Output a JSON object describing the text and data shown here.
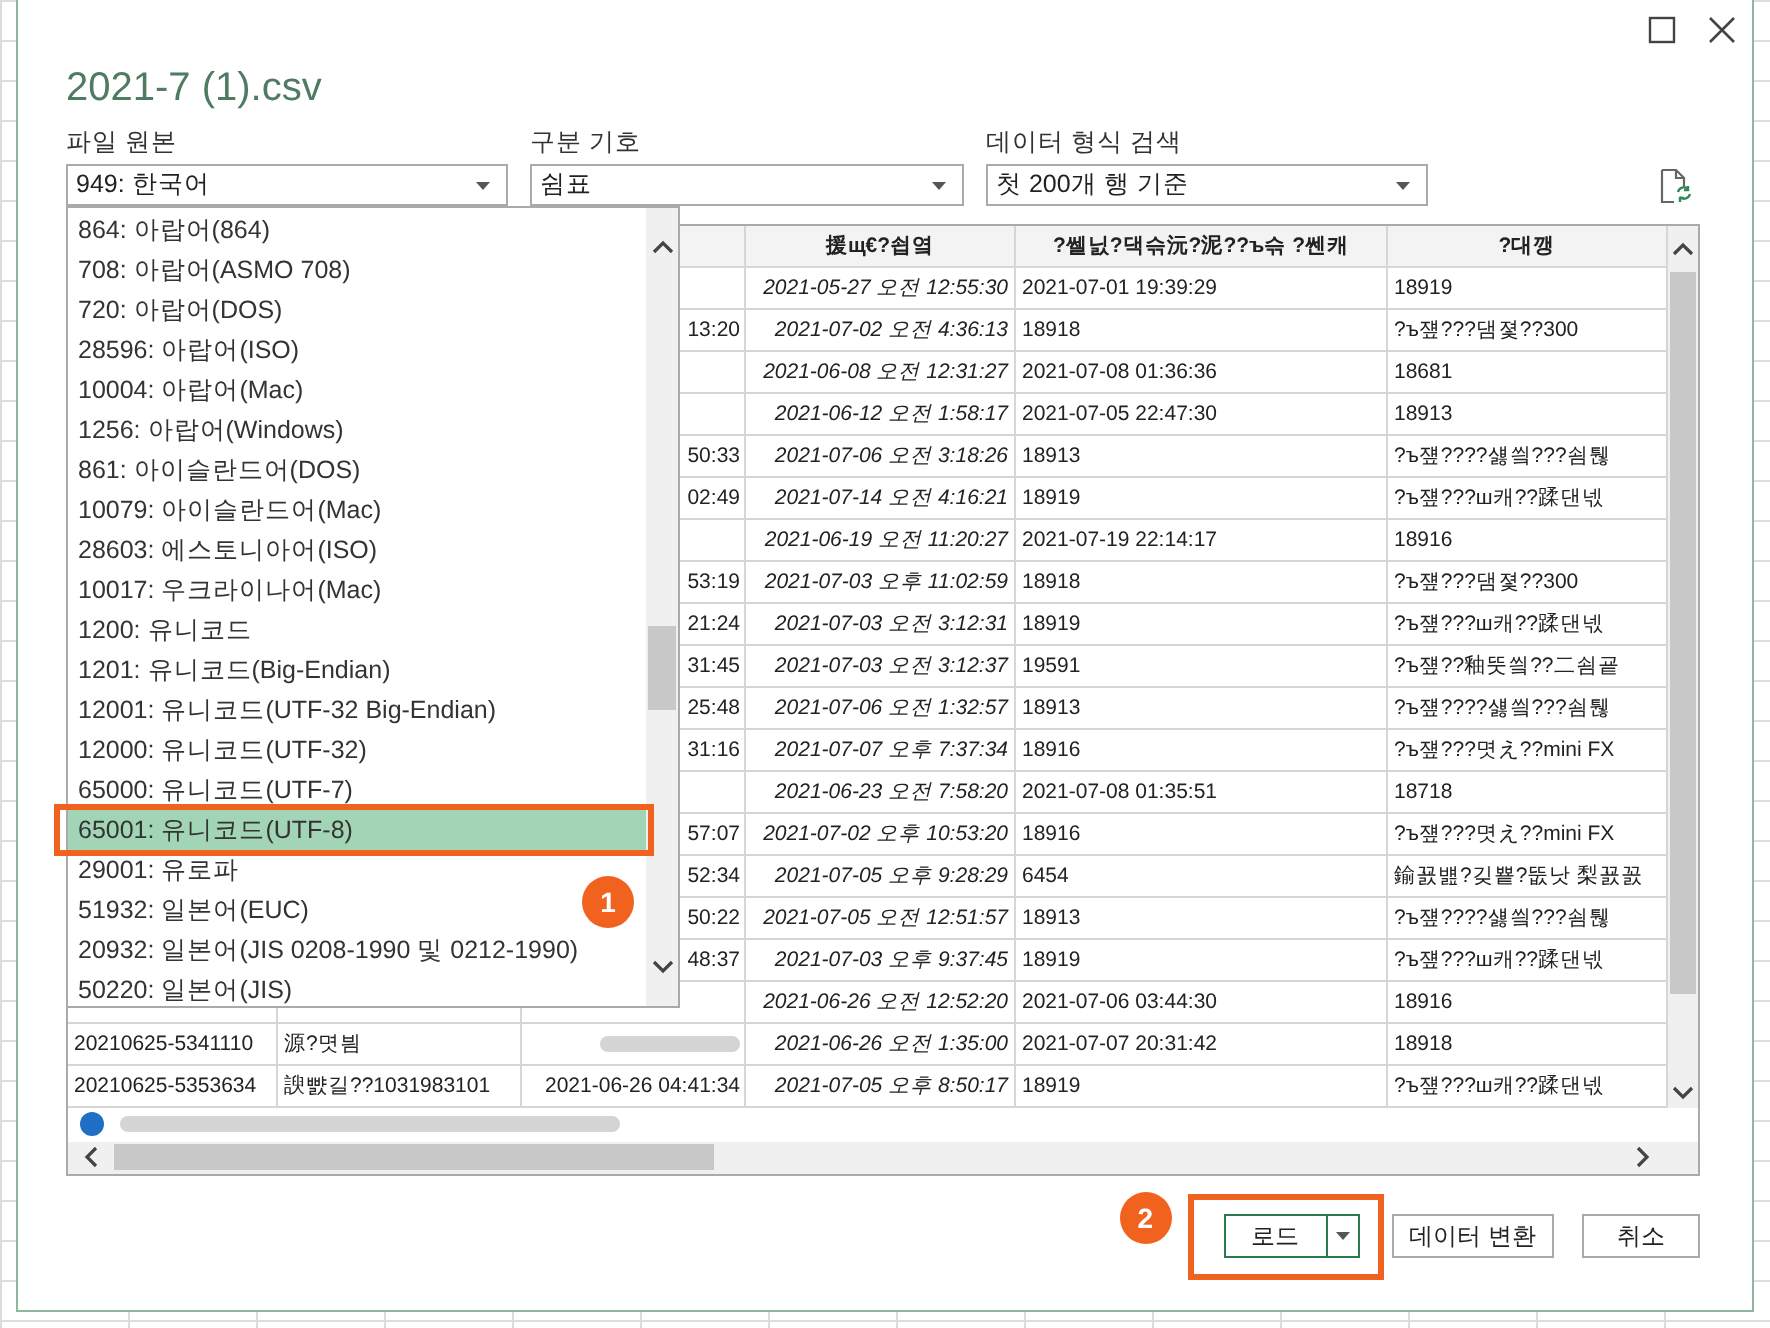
{
  "window": {
    "title": "2021-7 (1).csv"
  },
  "file_origin": {
    "label": "파일 원본",
    "value": "949: 한국어",
    "options": [
      {
        "label": "864: 아랍어(864)",
        "selected": false
      },
      {
        "label": "708: 아랍어(ASMO 708)",
        "selected": false
      },
      {
        "label": "720: 아랍어(DOS)",
        "selected": false
      },
      {
        "label": "28596: 아랍어(ISO)",
        "selected": false
      },
      {
        "label": "10004: 아랍어(Mac)",
        "selected": false
      },
      {
        "label": "1256: 아랍어(Windows)",
        "selected": false
      },
      {
        "label": "861: 아이슬란드어(DOS)",
        "selected": false
      },
      {
        "label": "10079: 아이슬란드어(Mac)",
        "selected": false
      },
      {
        "label": "28603: 에스토니아어(ISO)",
        "selected": false
      },
      {
        "label": "10017: 우크라이나어(Mac)",
        "selected": false
      },
      {
        "label": "1200: 유니코드",
        "selected": false
      },
      {
        "label": "1201: 유니코드(Big-Endian)",
        "selected": false
      },
      {
        "label": "12001: 유니코드(UTF-32 Big-Endian)",
        "selected": false
      },
      {
        "label": "12000: 유니코드(UTF-32)",
        "selected": false
      },
      {
        "label": "65000: 유니코드(UTF-7)",
        "selected": false
      },
      {
        "label": "65001: 유니코드(UTF-8)",
        "selected": true
      },
      {
        "label": "29001: 유로파",
        "selected": false
      },
      {
        "label": "51932: 일본어(EUC)",
        "selected": false
      },
      {
        "label": "20932: 일본어(JIS 0208-1990 및 0212-1990)",
        "selected": false
      },
      {
        "label": "50220: 일본어(JIS)",
        "selected": false
      }
    ]
  },
  "delimiter": {
    "label": "구분 기호",
    "value": "쉼표"
  },
  "detection": {
    "label": "데이터 형식 검색",
    "value": "첫 200개 행 기준"
  },
  "preview": {
    "columns": [
      null,
      null,
      null,
      "援щ€?쇱옄",
      "?쎌닔?댁슦沅?泥??ъ슦 ?쎈캐",
      "?대깽"
    ],
    "rows": [
      {
        "cells": [
          null,
          null,
          null,
          "2021-05-27 오전 12:55:30",
          "2021-07-01 19:39:29",
          "18919"
        ]
      },
      {
        "cells": [
          null,
          null,
          "13:20",
          "2021-07-02 오전 4:36:13",
          "18918",
          "?ъ쟾???댐졏??300"
        ]
      },
      {
        "cells": [
          null,
          null,
          null,
          "2021-06-08 오전 12:31:27",
          "2021-07-08 01:36:36",
          "18681"
        ]
      },
      {
        "cells": [
          null,
          null,
          null,
          "2021-06-12 오전 1:58:17",
          "2021-07-05 22:47:30",
          "18913"
        ]
      },
      {
        "cells": [
          null,
          null,
          "50:33",
          "2021-07-06 오전 3:18:26",
          "18913",
          "?ъ쟾????섏씤???쇰퉪"
        ]
      },
      {
        "cells": [
          null,
          null,
          "02:49",
          "2021-07-14 오전 4:16:21",
          "18919",
          "?ъ쟾???ш캐??蹂댄넧"
        ]
      },
      {
        "cells": [
          null,
          null,
          null,
          "2021-06-19 오전 11:20:27",
          "2021-07-19 22:14:17",
          "18916"
        ]
      },
      {
        "cells": [
          null,
          null,
          "53:19",
          "2021-07-03 오후 11:02:59",
          "18918",
          "?ъ쟾???댐졏??300"
        ]
      },
      {
        "cells": [
          null,
          null,
          "21:24",
          "2021-07-03 오전 3:12:31",
          "18919",
          "?ъ쟾???ш캐??蹂댄넧"
        ]
      },
      {
        "cells": [
          null,
          null,
          "31:45",
          "2021-07-03 오전 3:12:37",
          "19591",
          "?ъ쟾??釉뚯씤??二쇰굩"
        ]
      },
      {
        "cells": [
          null,
          null,
          "25:48",
          "2021-07-06 오전 1:32:57",
          "18913",
          "?ъ쟾????섏씤???쇰퉪"
        ]
      },
      {
        "cells": [
          null,
          null,
          "31:16",
          "2021-07-07 오후 7:37:34",
          "18916",
          "?ъ쟾???몃え??mini FX"
        ]
      },
      {
        "cells": [
          null,
          null,
          null,
          "2021-06-23 오전 7:58:20",
          "2021-07-08 01:35:51",
          "18718"
        ]
      },
      {
        "cells": [
          null,
          null,
          "57:07",
          "2021-07-02 오후 10:53:20",
          "18916",
          "?ъ쟾???몃え??mini FX"
        ]
      },
      {
        "cells": [
          null,
          null,
          "52:34",
          "2021-07-05 오후 9:28:29",
          "6454",
          "鍮꾨뱶?깆뿉?뚮낫 梨꾨꼸"
        ]
      },
      {
        "cells": [
          null,
          null,
          "50:22",
          "2021-07-05 오전 12:51:57",
          "18913",
          "?ъ쟾????섏씤???쇰퉪"
        ]
      },
      {
        "cells": [
          null,
          null,
          "48:37",
          "2021-07-03 오후 9:37:45",
          "18919",
          "?ъ쟾???ш캐??蹂댄넧"
        ]
      },
      {
        "cells": [
          null,
          null,
          null,
          "2021-06-26 오전 12:52:20",
          "2021-07-06 03:44:30",
          "18916"
        ]
      },
      {
        "cells": [
          "20210625-5341110",
          "源?몃븸",
          {
            "kind": "blurred"
          },
          "2021-06-26 오전 1:35:00",
          "2021-07-07 20:31:42",
          "18918"
        ]
      },
      {
        "cells": [
          "20210625-5353634",
          "諛뺤길??1031983101",
          "2021-06-26 04:41:34",
          "2021-07-05 오후 8:50:17",
          "18919",
          "?ъ쟾???ш캐??蹂댄넧"
        ]
      }
    ]
  },
  "annotations": {
    "list_badge": "1",
    "button_badge": "2"
  },
  "buttons": [
    {
      "label": "로드",
      "kind": "split",
      "default": true
    },
    {
      "label": "데이터 변환",
      "kind": "plain",
      "default": false
    },
    {
      "label": "취소",
      "kind": "plain",
      "default": false
    }
  ]
}
